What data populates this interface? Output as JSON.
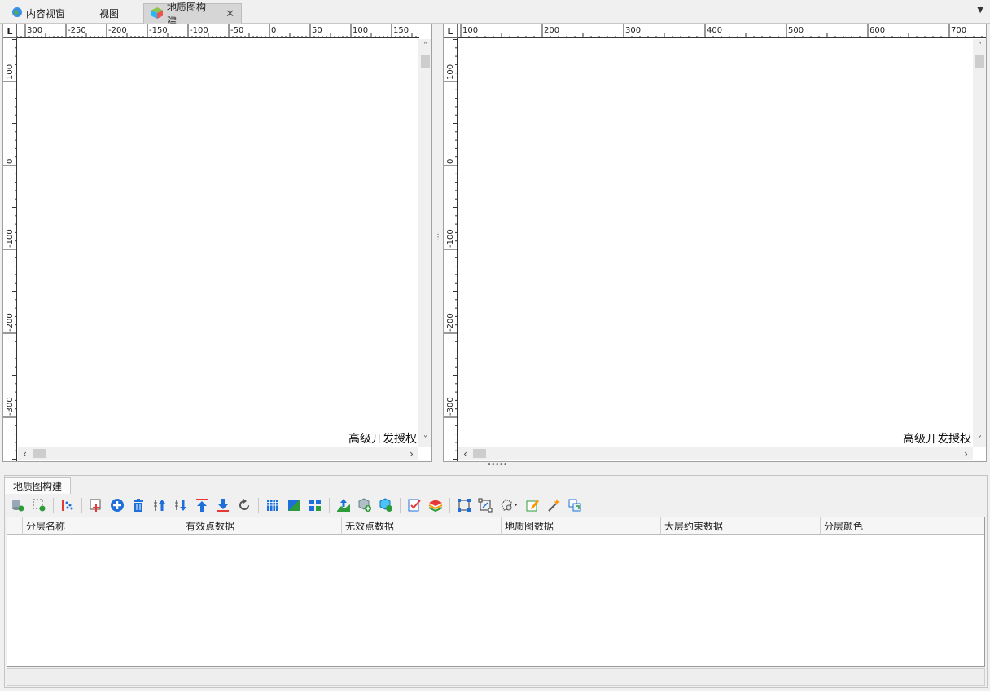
{
  "doc_tabs": [
    {
      "label": "内容视窗",
      "icon": "globe-icon"
    },
    {
      "label": "视图",
      "icon": ""
    },
    {
      "label": "地质图构建",
      "icon": "cube-icon",
      "active": true
    }
  ],
  "close_glyph": "✕",
  "dropdown_glyph": "▼",
  "corner_label": "L",
  "left_view": {
    "h_ruler_labels": [
      "300",
      "-250",
      "-200",
      "-150",
      "-100",
      "-50",
      "0",
      "50",
      "100",
      "150"
    ],
    "v_ruler_labels": [
      "100",
      "0",
      "-100",
      "-200",
      "-300"
    ],
    "watermark": "高级开发授权"
  },
  "right_view": {
    "h_ruler_labels": [
      "100",
      "200",
      "300",
      "400",
      "500",
      "600",
      "700"
    ],
    "v_ruler_labels": [
      "100",
      "0",
      "-100",
      "-200",
      "-300"
    ],
    "watermark": "高级开发授权"
  },
  "scroll_glyphs": {
    "up": "˄",
    "down": "˅",
    "left": "‹",
    "right": "›"
  },
  "panel": {
    "tab_label": "地质图构建",
    "columns": [
      "",
      "分层名称",
      "有效点数据",
      "无效点数据",
      "地质图数据",
      "大层约束数据",
      "分层颜色"
    ]
  },
  "colors": {
    "accent_blue": "#1e6fd9",
    "accent_red": "#e53935",
    "accent_green": "#2e9b3a"
  }
}
